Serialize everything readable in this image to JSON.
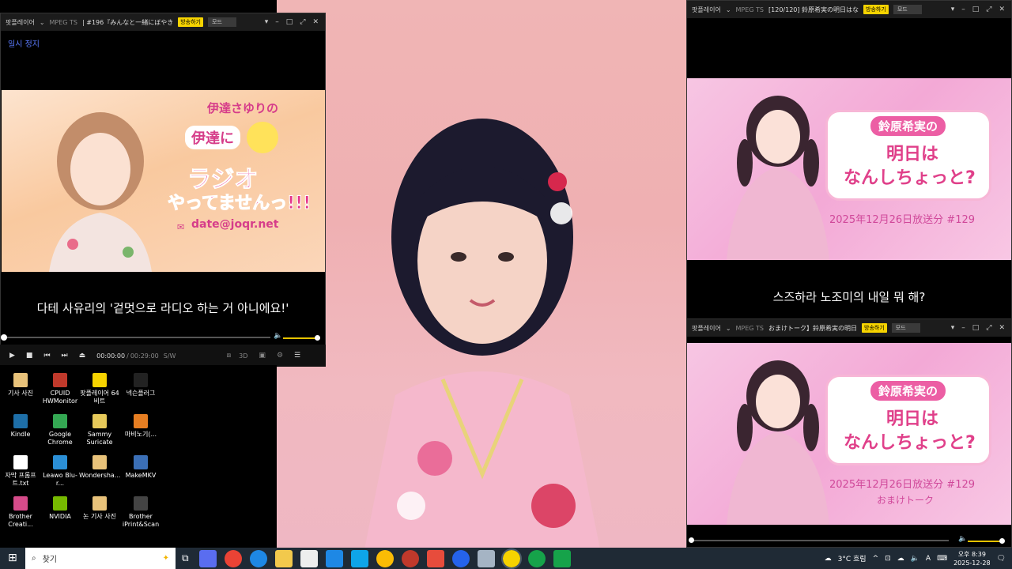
{
  "left_player": {
    "brand": "팟플레이어",
    "format": "MPEG TS",
    "title": "| #196『みんなと一緒にぼやき",
    "broadcast": "방송하기",
    "mode": "모드",
    "status": "일시 정지",
    "poster_title_1": "伊達さゆりの",
    "poster_title_2": "伊達に",
    "poster_title_3": "ラジオ",
    "poster_title_4": "やってませんっ!!!",
    "poster_email": "date@joqr.net",
    "subtitle": "다테 사유리의 '겉멋으로 라디오 하는 거 아니에요!'",
    "time_current": "00:00:00",
    "time_total": "00:29:00",
    "time_mode": "S/W",
    "progress": 0
  },
  "right_top_player": {
    "brand": "팟플레이어",
    "format": "MPEG TS",
    "title": "[120/120] 鈴原希実の明日はな",
    "broadcast": "방송하기",
    "mode": "모드",
    "poster_title_1": "鈴原希実の",
    "poster_title_2": "明日は",
    "poster_title_3": "なんしちょっと?",
    "poster_date": "2025年12月26日放送分 #129",
    "subtitle": "스즈하라 노조미의 내일 뭐 해?"
  },
  "right_bottom_player": {
    "brand": "팟플레이어",
    "format": "MPEG TS",
    "title": "おまけトーク】鈴原希実の明日",
    "broadcast": "방송하기",
    "mode": "모드",
    "poster_title_1": "鈴原希実の",
    "poster_title_2": "明日は",
    "poster_title_3": "なんしちょっと?",
    "poster_date": "2025年12月26日放送分 #129",
    "poster_extra": "おまけトーク",
    "progress": 0
  },
  "desktop_icons": [
    {
      "label": "기사 사진",
      "color": "#e8c27a"
    },
    {
      "label": "CPUID HWMonitor",
      "color": "#c0392b"
    },
    {
      "label": "팟플레이어 64 비트",
      "color": "#f6d300"
    },
    {
      "label": "넥슨플러그",
      "color": "#222222"
    },
    {
      "label": "Kindle",
      "color": "#1e6fa8"
    },
    {
      "label": "Google Chrome",
      "color": "#34a853"
    },
    {
      "label": "Sammy Suricate",
      "color": "#e6c95a"
    },
    {
      "label": "마비노기(...",
      "color": "#e67e22"
    },
    {
      "label": "자막 프롬프트.txt",
      "color": "#ffffff"
    },
    {
      "label": "Leawo Blu-r...",
      "color": "#2b8fd6"
    },
    {
      "label": "Wondersha...",
      "color": "#e8c27a"
    },
    {
      "label": "MakeMKV",
      "color": "#3b6fb6"
    },
    {
      "label": "Brother Creati...",
      "color": "#d64b8a"
    },
    {
      "label": "NVIDIA",
      "color": "#76b900"
    },
    {
      "label": "논 기사 사진",
      "color": "#e8c27a"
    },
    {
      "label": "Brother iPrint&Scan",
      "color": "#444444"
    }
  ],
  "taskbar": {
    "search_placeholder": "찾기",
    "weather": "3°C 흐림",
    "ime": "A",
    "time": "오후 8:39",
    "date": "2025-12-28"
  }
}
